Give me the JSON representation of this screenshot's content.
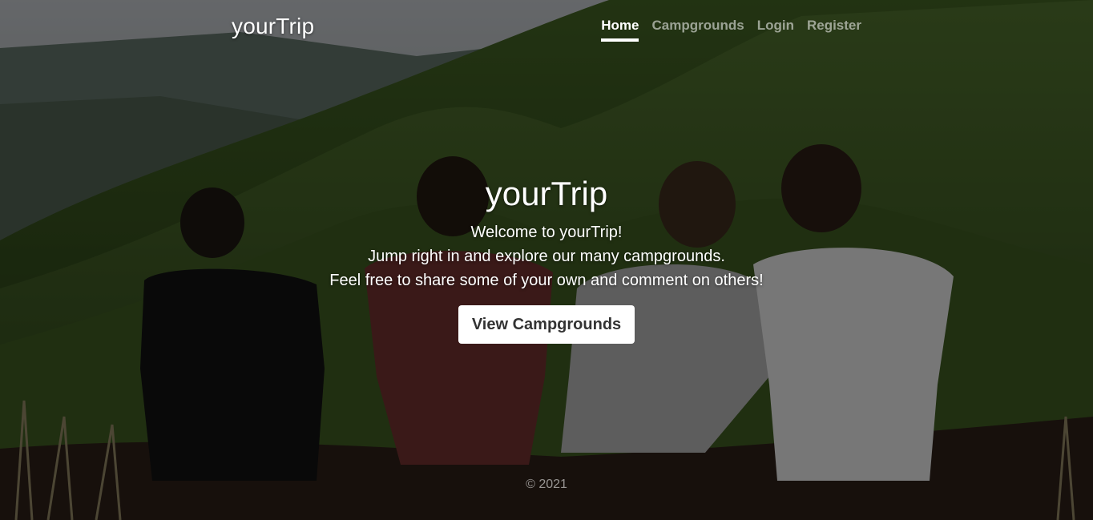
{
  "navbar": {
    "brand": "yourTrip",
    "links": [
      {
        "label": "Home",
        "active": true
      },
      {
        "label": "Campgrounds",
        "active": false
      },
      {
        "label": "Login",
        "active": false
      },
      {
        "label": "Register",
        "active": false
      }
    ]
  },
  "hero": {
    "title": "yourTrip",
    "lines": [
      "Welcome to yourTrip!",
      "Jump right in and explore our many campgrounds.",
      "Feel free to share some of your own and comment on others!"
    ],
    "button_label": "View Campgrounds"
  },
  "footer": {
    "copyright": "© 2021"
  },
  "colors": {
    "overlay": "#000000",
    "text": "#ffffff",
    "muted_text": "#a0a0a0",
    "button_bg": "#ffffff",
    "button_text": "#333333"
  }
}
